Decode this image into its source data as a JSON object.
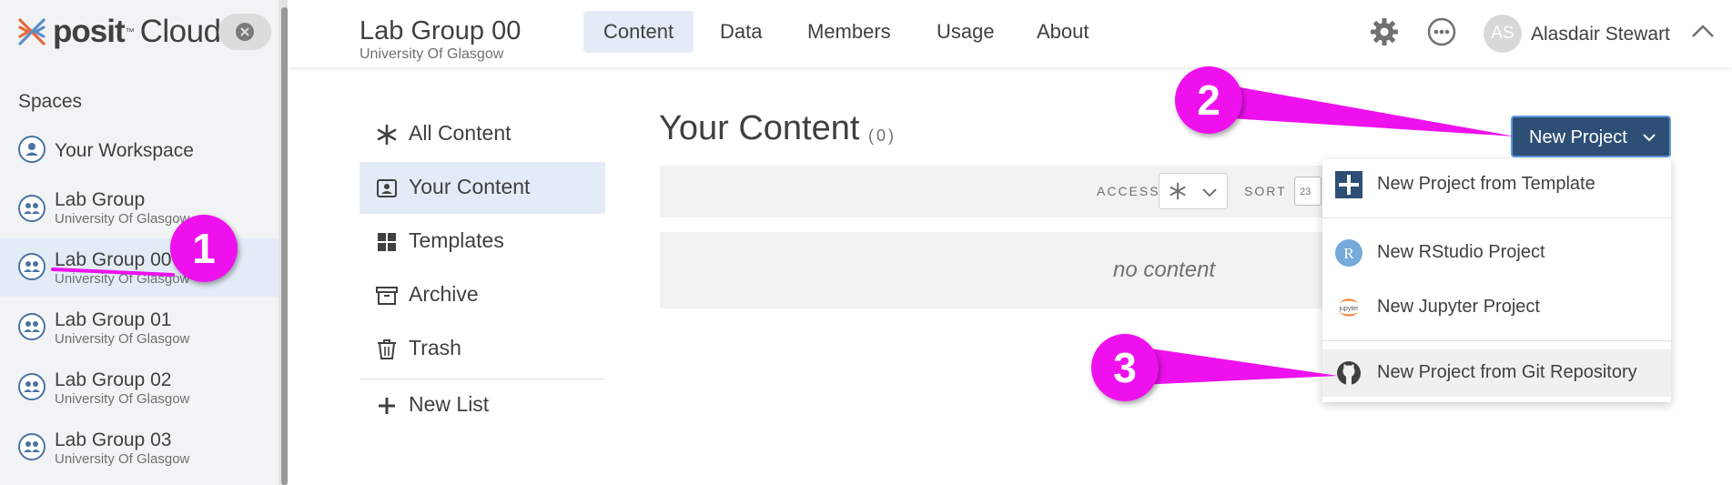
{
  "brand": {
    "name_bold": "posit",
    "name_light": "Cloud",
    "tm": "™"
  },
  "sidebar": {
    "spaces_title": "Spaces",
    "items": [
      {
        "name": "Your Workspace",
        "org": ""
      },
      {
        "name": "Lab Group",
        "org": "University Of Glasgow"
      },
      {
        "name": "Lab Group 00",
        "org": "University Of Glasgow"
      },
      {
        "name": "Lab Group 01",
        "org": "University Of Glasgow"
      },
      {
        "name": "Lab Group 02",
        "org": "University Of Glasgow"
      },
      {
        "name": "Lab Group 03",
        "org": "University Of Glasgow"
      }
    ],
    "active_index": 2
  },
  "header": {
    "title": "Lab Group 00",
    "org": "University Of Glasgow",
    "tabs": [
      "Content",
      "Data",
      "Members",
      "Usage",
      "About"
    ],
    "active_tab": "Content",
    "user": {
      "initials": "AS",
      "name": "Alasdair Stewart"
    }
  },
  "content_nav": {
    "items": [
      "All Content",
      "Your Content",
      "Templates",
      "Archive",
      "Trash"
    ],
    "active": "Your Content",
    "new_list": "New List"
  },
  "main": {
    "title": "Your Content",
    "count": "(0)",
    "access_label": "ACCESS",
    "sort_label": "SORT",
    "sort_icon_text": "23",
    "empty_text": "no content",
    "new_project_label": "New Project"
  },
  "dropdown": {
    "items": [
      "New Project from Template",
      "New RStudio Project",
      "New Jupyter Project",
      "New Project from Git Repository"
    ],
    "jupyter_icon_text": "jupyter",
    "rstudio_icon_text": "R"
  },
  "annotations": [
    "1",
    "2",
    "3"
  ],
  "colors": {
    "accent": "#2e4f75",
    "annotation": "#ee11ee",
    "active_bg": "#e3ecf6"
  }
}
